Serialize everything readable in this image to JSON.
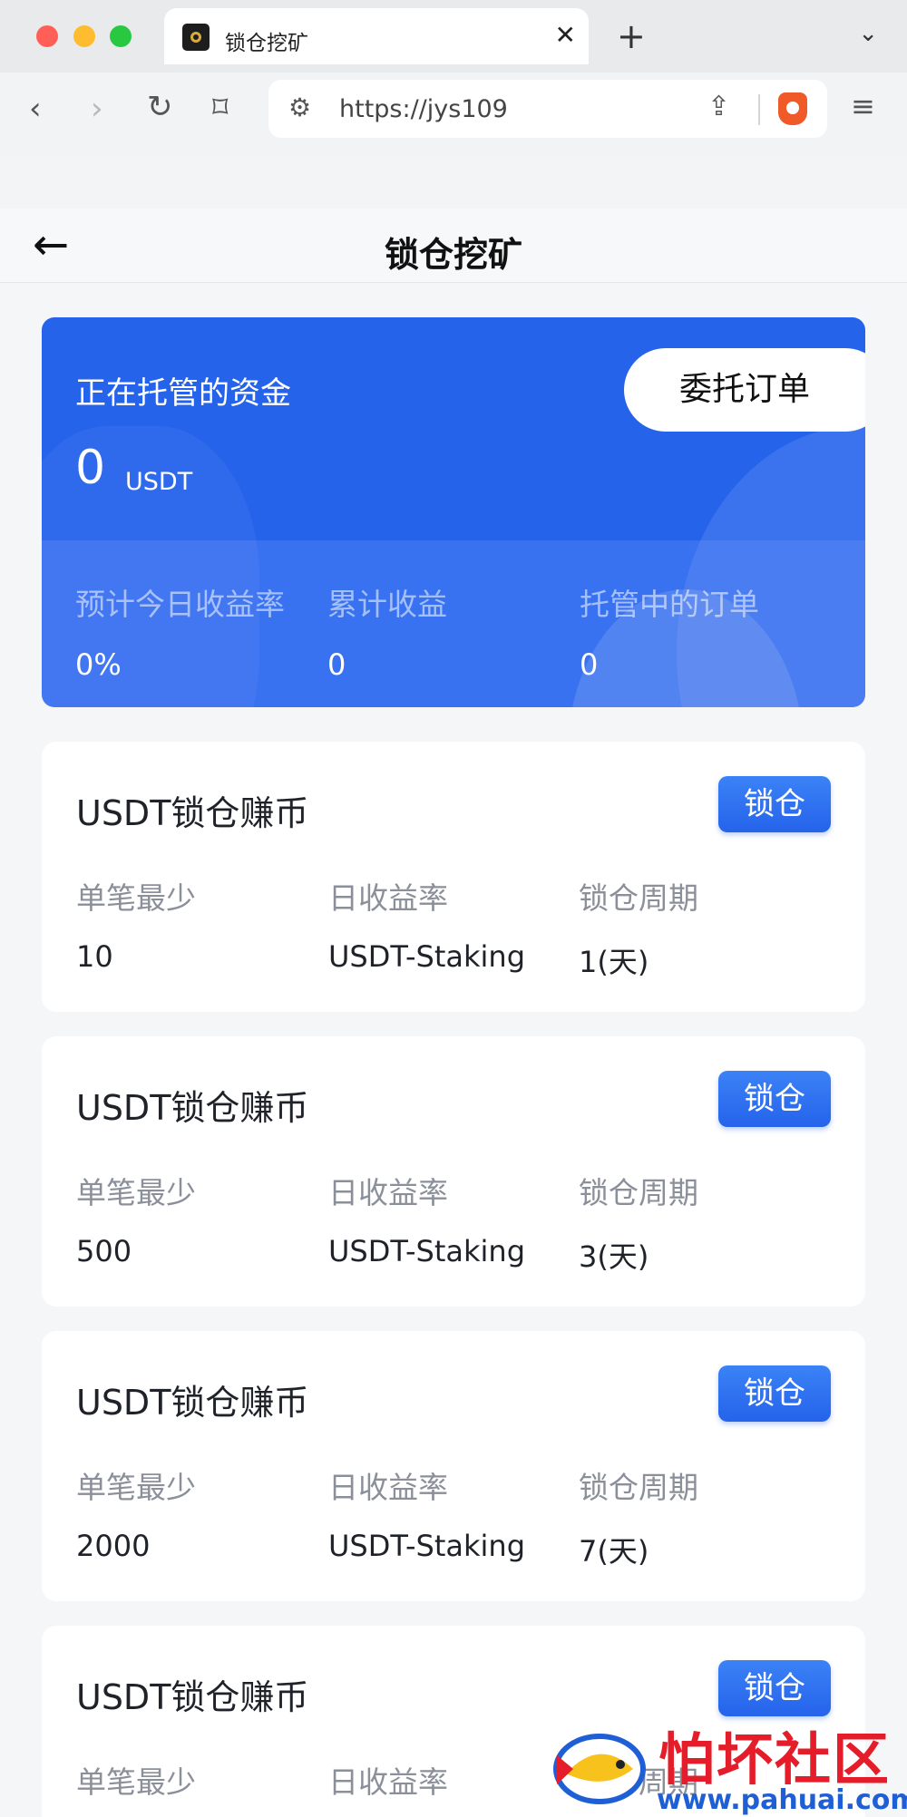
{
  "browser": {
    "tab_title": "锁仓挖矿",
    "tab_close": "✕",
    "new_tab": "+",
    "tab_menu": "⌄",
    "url": "https://jys109",
    "nav_back": "‹",
    "nav_forward": "›",
    "reload": "↻",
    "bookmark": "⌑",
    "settings_icon": "⚙",
    "share_icon": "⇪",
    "menu_icon": "≡"
  },
  "header": {
    "back_icon": "←",
    "title": "锁仓挖矿"
  },
  "hero": {
    "label": "正在托管的资金",
    "amount": "0",
    "unit": "USDT",
    "entrust_button": "委托订单",
    "stats": [
      {
        "label": "预计今日收益率",
        "value": "0%"
      },
      {
        "label": "累计收益",
        "value": "0"
      },
      {
        "label": "托管中的订单",
        "value": "0"
      }
    ]
  },
  "products": [
    {
      "title": "USDT锁仓赚币",
      "button": "锁仓",
      "min_label": "单笔最少",
      "min_value": "10",
      "rate_label": "日收益率",
      "rate_value": "USDT-Staking",
      "period_label": "锁仓周期",
      "period_value": "1(天)"
    },
    {
      "title": "USDT锁仓赚币",
      "button": "锁仓",
      "min_label": "单笔最少",
      "min_value": "500",
      "rate_label": "日收益率",
      "rate_value": "USDT-Staking",
      "period_label": "锁仓周期",
      "period_value": "3(天)"
    },
    {
      "title": "USDT锁仓赚币",
      "button": "锁仓",
      "min_label": "单笔最少",
      "min_value": "2000",
      "rate_label": "日收益率",
      "rate_value": "USDT-Staking",
      "period_label": "锁仓周期",
      "period_value": "7(天)"
    },
    {
      "title": "USDT锁仓赚币",
      "button": "锁仓",
      "min_label": "单笔最少",
      "min_value": "",
      "rate_label": "日收益率",
      "rate_value": "",
      "period_label": "锁仓周期",
      "period_value": ""
    }
  ],
  "watermark": {
    "text": "怕坏社区",
    "url": "www.pahuai.com"
  },
  "colors": {
    "accent": "#2563eb",
    "page_bg": "#f5f6f8",
    "watermark_red": "#e51d2a",
    "watermark_blue": "#1f5fd6"
  }
}
